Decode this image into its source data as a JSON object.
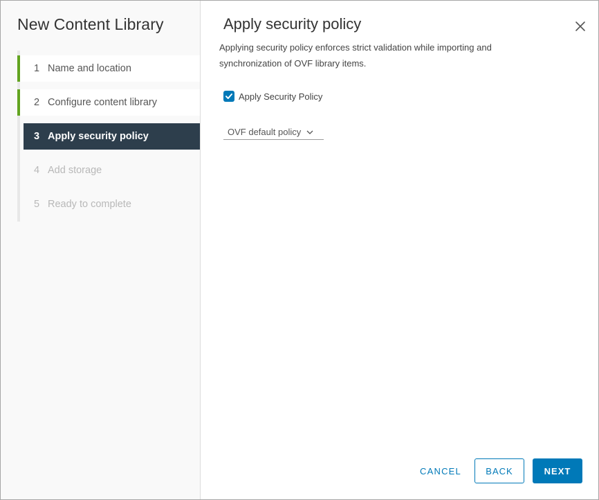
{
  "colors": {
    "accent": "#0079b8",
    "active_step_bg": "#2d3e4c",
    "completed_step_marker": "#62a420",
    "disabled_text": "#b8b8b8"
  },
  "wizard": {
    "title": "New Content Library",
    "steps": [
      {
        "number": "1",
        "label": "Name and location",
        "state": "completed"
      },
      {
        "number": "2",
        "label": "Configure content library",
        "state": "completed"
      },
      {
        "number": "3",
        "label": "Apply security policy",
        "state": "active"
      },
      {
        "number": "4",
        "label": "Add storage",
        "state": "disabled"
      },
      {
        "number": "5",
        "label": "Ready to complete",
        "state": "disabled"
      }
    ]
  },
  "main": {
    "title": "Apply security policy",
    "description": "Applying security policy enforces strict validation while importing and synchronization of OVF library items.",
    "checkbox": {
      "label": "Apply Security Policy",
      "checked": true,
      "icon": "checkmark-icon"
    },
    "policy_select": {
      "value": "OVF default policy",
      "icon": "chevron-down-icon"
    },
    "close_icon": "close-icon"
  },
  "footer": {
    "cancel_label": "CANCEL",
    "back_label": "BACK",
    "next_label": "NEXT"
  }
}
